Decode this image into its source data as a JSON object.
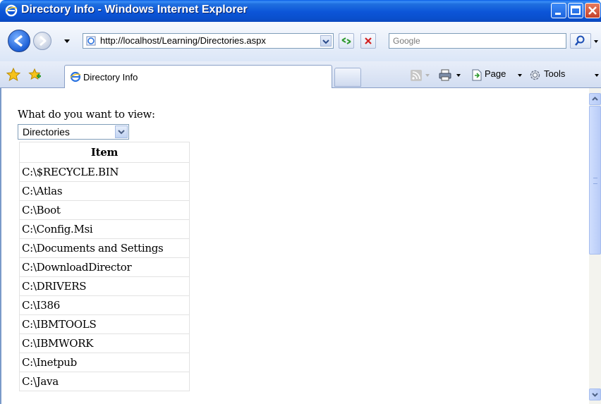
{
  "window": {
    "title": "Directory Info - Windows Internet Explorer"
  },
  "addressbar": {
    "url": "http://localhost/Learning/Directories.aspx",
    "search_placeholder": "Google"
  },
  "tabs": [
    {
      "label": "Directory Info"
    }
  ],
  "commandbar": {
    "page_label": "Page",
    "tools_label": "Tools"
  },
  "page": {
    "prompt": "What do you want to view:",
    "select_value": "Directories",
    "table": {
      "header": "Item",
      "rows": [
        "C:\\$RECYCLE.BIN",
        "C:\\Atlas",
        "C:\\Boot",
        "C:\\Config.Msi",
        "C:\\Documents and Settings",
        "C:\\DownloadDirector",
        "C:\\DRIVERS",
        "C:\\I386",
        "C:\\IBMTOOLS",
        "C:\\IBMWORK",
        "C:\\Inetpub",
        "C:\\Java"
      ]
    }
  },
  "colors": {
    "titlebar": "#0c55d8",
    "close_button": "#c4412a"
  }
}
